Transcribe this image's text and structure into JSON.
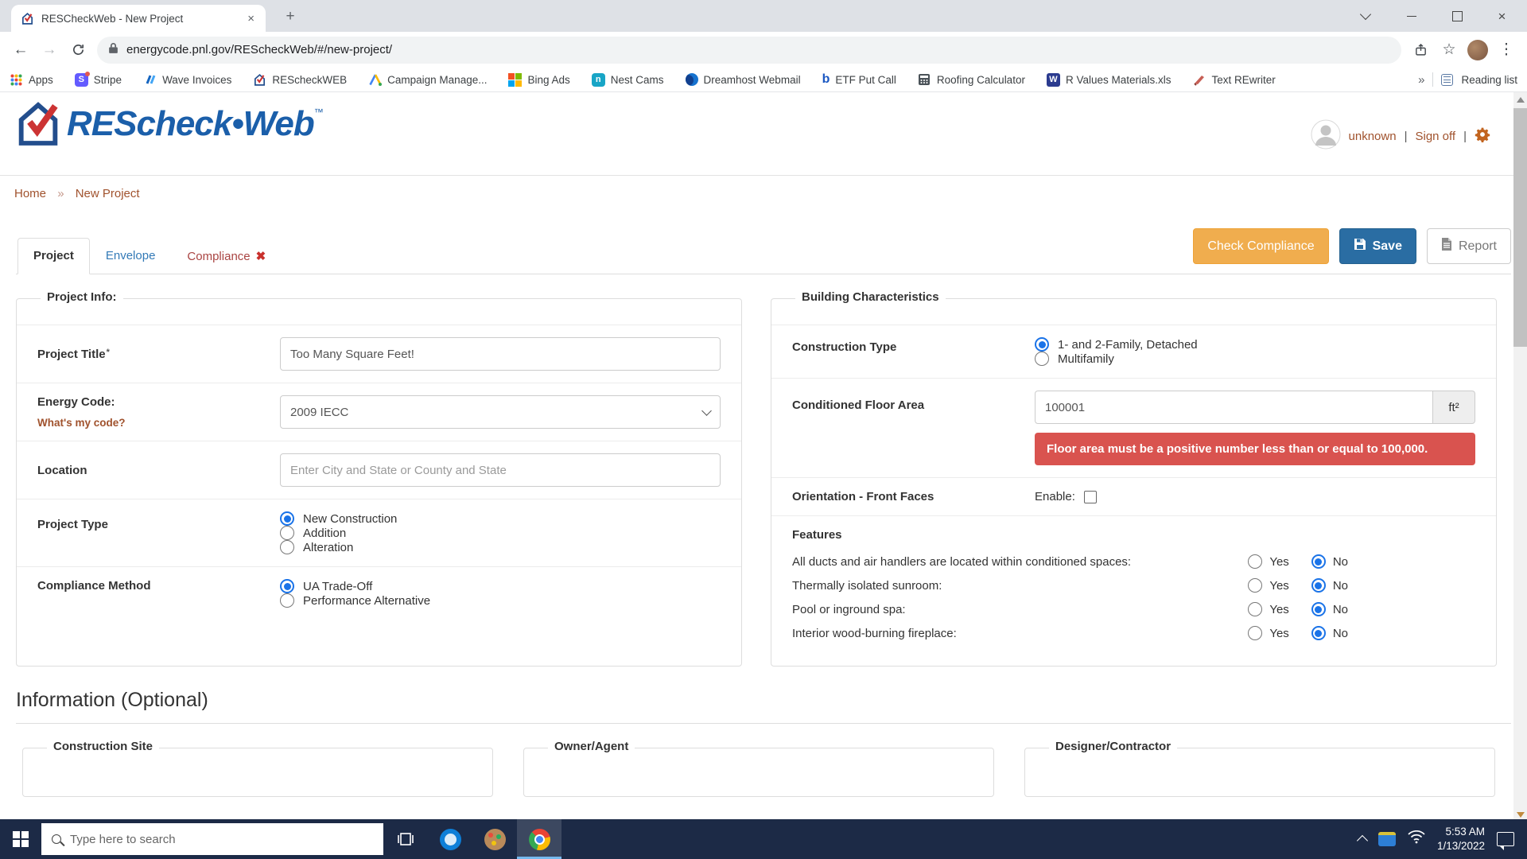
{
  "browser": {
    "tab": {
      "title": "RESCheckWeb - New Project",
      "close_glyph": "×",
      "new_tab_glyph": "+"
    },
    "toolbar": {
      "back": "←",
      "forward": "→",
      "url": "energycode.pnl.gov/REScheckWeb/#/new-project/",
      "star": "☆",
      "kebab": "⋮"
    },
    "bookmark_glyphs": {
      "stripe": "S",
      "nest": "n",
      "etf": "b",
      "word": "W"
    },
    "bookmarks": [
      {
        "label": "Apps"
      },
      {
        "label": "Stripe"
      },
      {
        "label": "Wave Invoices"
      },
      {
        "label": "REScheckWEB"
      },
      {
        "label": "Campaign Manage..."
      },
      {
        "label": "Bing Ads"
      },
      {
        "label": "Nest Cams"
      },
      {
        "label": "Dreamhost Webmail"
      },
      {
        "label": "ETF Put Call"
      },
      {
        "label": "Roofing Calculator"
      },
      {
        "label": "R Values Materials.xls"
      },
      {
        "label": "Text REwriter"
      }
    ],
    "overflow_glyph": "»",
    "reading_list": "Reading list"
  },
  "header": {
    "logo_main": "REScheck",
    "logo_dot": "•",
    "logo_web": "Web",
    "logo_tm": "™",
    "user_name": "unknown",
    "sep1": "|",
    "sign_off": "Sign off",
    "sep2": "|"
  },
  "breadcrumb": {
    "home": "Home",
    "sep": "»",
    "current": "New Project"
  },
  "nav": {
    "project": "Project",
    "envelope": "Envelope",
    "compliance": "Compliance",
    "fail_mark": "✖"
  },
  "actions": {
    "check_compliance": "Check Compliance",
    "save": "Save",
    "report": "Report"
  },
  "project_info": {
    "legend": "Project Info:",
    "title_label": "Project Title",
    "required_mark": "*",
    "title_value": "Too Many Square Feet!",
    "energy_code_label": "Energy Code:",
    "whats_my_code": "What's my code?",
    "energy_code_value": "2009 IECC",
    "location_label": "Location",
    "location_placeholder": "Enter City and State or County and State",
    "project_type_label": "Project Type",
    "project_type_options": [
      "New Construction",
      "Addition",
      "Alteration"
    ],
    "compliance_method_label": "Compliance Method",
    "compliance_method_options": [
      "UA Trade-Off",
      "Performance Alternative"
    ]
  },
  "building": {
    "legend": "Building Characteristics",
    "construction_type_label": "Construction Type",
    "construction_type_options": [
      "1- and 2-Family, Detached",
      "Multifamily"
    ],
    "floor_area_label": "Conditioned Floor Area",
    "floor_area_value": "100001",
    "floor_area_unit": "ft²",
    "floor_area_error": "Floor area must be a positive number less than or equal to 100,000.",
    "orientation_label": "Orientation - Front Faces",
    "orientation_enable": "Enable:",
    "features_label": "Features",
    "yes": "Yes",
    "no": "No",
    "features": [
      "All ducts and air handlers are located within conditioned spaces:",
      "Thermally isolated sunroom:",
      "Pool or inground spa:",
      "Interior wood-burning fireplace:"
    ]
  },
  "info_optional": {
    "heading": "Information (Optional)",
    "sections": [
      "Construction Site",
      "Owner/Agent",
      "Designer/Contractor"
    ]
  },
  "taskbar": {
    "search_placeholder": "Type here to search",
    "time": "5:53 AM",
    "date": "1/13/2022"
  },
  "colors": {
    "accent_orange": "#f0ad4e",
    "accent_blue": "#2a6da3",
    "error_red": "#d9534f",
    "link_brown": "#a0522d",
    "tab_blue": "#337ab7",
    "danger_red": "#a94442"
  }
}
